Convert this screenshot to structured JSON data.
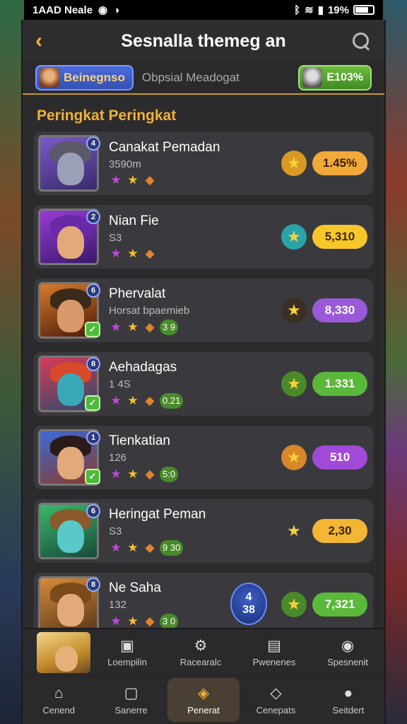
{
  "status_bar": {
    "time": "1AAD Neale",
    "battery_text": "19%"
  },
  "header": {
    "title": "Sesnalla themeg an"
  },
  "filter": {
    "active_chip": "Beinegnso",
    "label": "Obpsial Meadogat",
    "score_chip": "E103%"
  },
  "section_title": "Peringkat Peringkat",
  "players": [
    {
      "name": "Canakat Pemadan",
      "sub": "3590m",
      "rank": "4",
      "score": "1.45%",
      "score_bg": "#f2a93a",
      "score_color": "#3a2200",
      "medal": "★",
      "medal_bg": "#d89a22",
      "check": false,
      "gems_text": ""
    },
    {
      "name": "Nian Fie",
      "sub": "S3",
      "rank": "2",
      "score": "5,310",
      "score_bg": "#f7c62a",
      "score_color": "#3a2a00",
      "medal": "★",
      "medal_bg": "#2aa3a8",
      "check": false,
      "gems_text": ""
    },
    {
      "name": "Phervalat",
      "sub": "Horsat bpaemieb",
      "rank": "6",
      "score": "8,330",
      "score_bg": "#9a5ad8",
      "score_color": "#fff",
      "medal": "★",
      "medal_bg": "#3a2f22",
      "check": true,
      "gems_text": "3 9"
    },
    {
      "name": "Aehadagas",
      "sub": "1 4S",
      "rank": "8",
      "score": "1.331",
      "score_bg": "#5ab83a",
      "score_color": "#fff",
      "medal": "★",
      "medal_bg": "#4a8a2a",
      "check": true,
      "gems_text": "0.21"
    },
    {
      "name": "Tienkatian",
      "sub": "126",
      "rank": "1",
      "score": "510",
      "score_bg": "#a24ad8",
      "score_color": "#fff",
      "medal": "★",
      "medal_bg": "#d8882a",
      "check": true,
      "gems_text": "5:0"
    },
    {
      "name": "Heringat Peman",
      "sub": "S3",
      "rank": "6",
      "score": "2,30",
      "score_bg": "#f2b633",
      "score_color": "#3a2200",
      "medal": "★",
      "medal_bg": "transparent",
      "check": false,
      "gems_text": "9 30"
    },
    {
      "name": "Ne Saha",
      "sub": "132",
      "rank": "8",
      "score": "7,321",
      "score_bg": "#5ab83a",
      "score_color": "#fff",
      "medal": "★",
      "medal_bg": "#4a8a2a",
      "check": false,
      "gems_text": "3 0"
    }
  ],
  "round_badge": {
    "top": "4",
    "bottom": "38"
  },
  "nav_row1": [
    {
      "label": "Loempilin",
      "icon": "▣"
    },
    {
      "label": "Racearalc",
      "icon": "⚙"
    },
    {
      "label": "Pwenenes",
      "icon": "▤"
    },
    {
      "label": "Spesnenit",
      "icon": "◉"
    }
  ],
  "nav_row2": [
    {
      "label": "Cenend",
      "icon": "⌂"
    },
    {
      "label": "Sanerre",
      "icon": "▢"
    },
    {
      "label": "Penerat",
      "icon": "◈"
    },
    {
      "label": "Cenepats",
      "icon": "◇"
    },
    {
      "label": "Seitdert",
      "icon": "●"
    }
  ],
  "colors": {
    "accent": "#f2b233",
    "panel": "#2b2b2e",
    "row": "#3a3a3e"
  }
}
